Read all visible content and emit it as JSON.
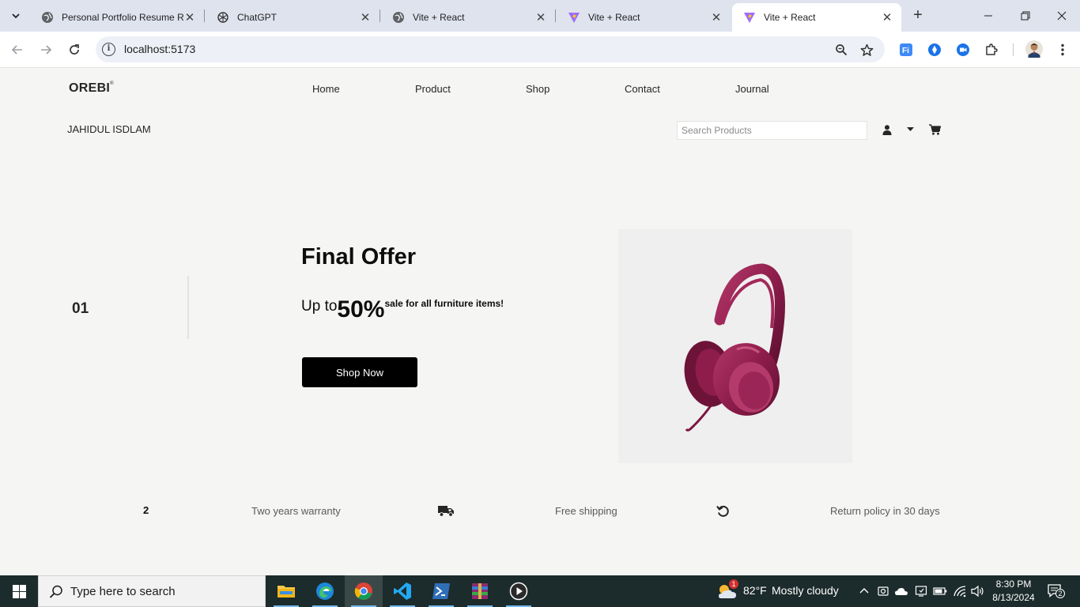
{
  "browser": {
    "tabs": [
      {
        "title": "Personal Portfolio Resume R",
        "favicon": "globe-icon",
        "active": false
      },
      {
        "title": "ChatGPT",
        "favicon": "chatgpt-icon",
        "active": false
      },
      {
        "title": "Vite + React",
        "favicon": "globe-icon",
        "active": false
      },
      {
        "title": "Vite + React",
        "favicon": "vite-icon",
        "active": false
      },
      {
        "title": "Vite + React",
        "favicon": "vite-icon",
        "active": true
      }
    ],
    "url": "localhost:5173"
  },
  "site": {
    "logo": "OREBI",
    "logo_mark": "®",
    "nav": [
      "Home",
      "Product",
      "Shop",
      "Contact",
      "Journal"
    ],
    "user_name": "JAHIDUL ISDLAM",
    "search_placeholder": "Search Products"
  },
  "hero": {
    "slide_number": "01",
    "title": "Final Offer",
    "subtitle_prefix": "Up to",
    "subtitle_percent": "50%",
    "subtitle_suffix": "sale for all furniture items!",
    "button": "Shop Now",
    "image": "headphones-image",
    "image_color": "#8e1d4b"
  },
  "features": {
    "warranty_number": "2",
    "warranty": "Two years warranty",
    "shipping": "Free shipping",
    "returns": "Return policy in 30 days"
  },
  "taskbar": {
    "search_label": "Type here to search",
    "weather_temp": "82°F",
    "weather_text": "Mostly cloudy",
    "weather_badge": "1",
    "time": "8:30 PM",
    "date": "8/13/2024",
    "notification_count": "2"
  }
}
